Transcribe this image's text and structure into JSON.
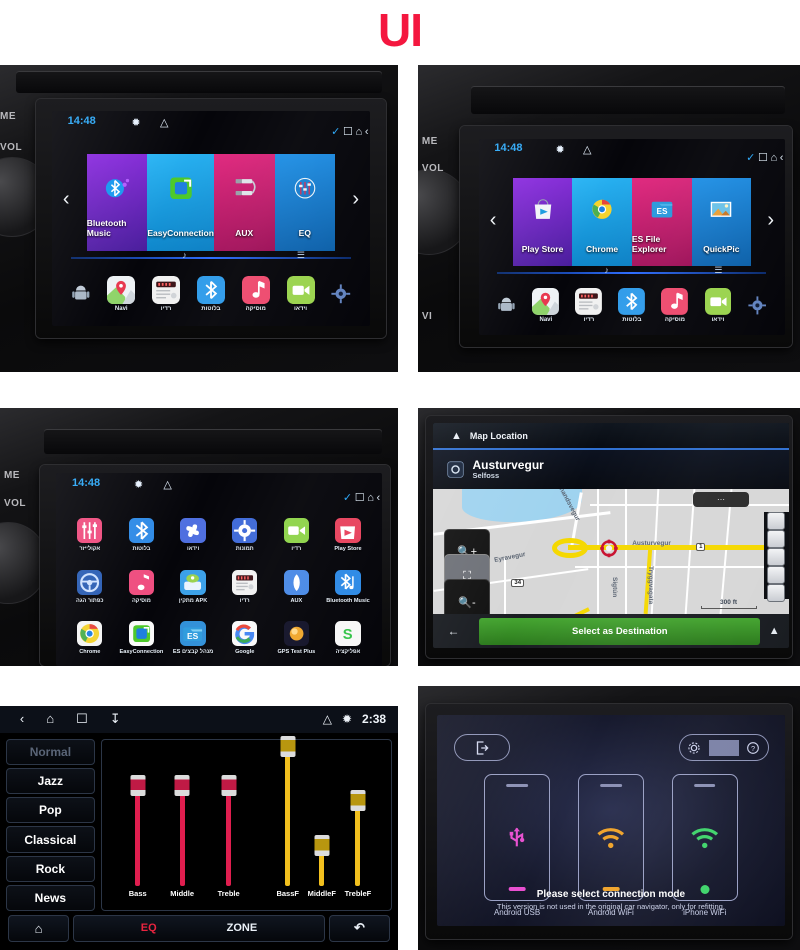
{
  "page": {
    "title": "UI",
    "title_color": "#f4173f"
  },
  "panel1": {
    "name": "car-head-unit-home-media",
    "dash_labels": [
      "ME",
      "VOL"
    ],
    "status": {
      "clock": "14:48",
      "bluetooth_icon": "bluetooth-icon",
      "eject_icon": "eject-icon"
    },
    "nav": {
      "check_icon": "check-icon",
      "recents_icon": "recents-icon",
      "home_icon": "home-icon",
      "back_icon": "back-icon"
    },
    "arrows": {
      "left": "‹",
      "right": "›"
    },
    "tiles": [
      {
        "label": "Bluetooth Music",
        "icon": "bluetooth-music-icon",
        "color": "#7b1fd6"
      },
      {
        "label": "EasyConnection",
        "icon": "easyconnection-icon",
        "color": "#19a8e8"
      },
      {
        "label": "AUX",
        "icon": "aux-rca-icon",
        "color": "#d6197b"
      },
      {
        "label": "EQ",
        "icon": "equalizer-icon",
        "color": "#1a7fd6"
      }
    ],
    "dock": [
      {
        "label": "Navi",
        "icon": "maps-pin-icon"
      },
      {
        "label": "רדיו",
        "icon": "radio-icon"
      },
      {
        "label": "בלוטות",
        "icon": "bluetooth-icon"
      },
      {
        "label": "מוסיקה",
        "icon": "music-note-icon"
      },
      {
        "label": "וידאו",
        "icon": "video-camera-icon"
      }
    ],
    "sys_left_icon": "android-robot-icon",
    "sys_right_icon": "settings-gear-icon",
    "dockbar_left_icon": "music-swirl-icon",
    "dockbar_right_icon": "signal-bars-icon"
  },
  "panel2": {
    "name": "car-head-unit-home-apps",
    "dash_labels": [
      "ME",
      "VOL",
      "VI"
    ],
    "status": {
      "clock": "14:48",
      "bluetooth_icon": "bluetooth-icon",
      "eject_icon": "eject-icon"
    },
    "nav": {
      "check_icon": "check-icon",
      "recents_icon": "recents-icon",
      "home_icon": "home-icon",
      "back_icon": "back-icon"
    },
    "arrows": {
      "left": "‹",
      "right": "›"
    },
    "tiles": [
      {
        "label": "Play Store",
        "icon": "play-store-icon",
        "color": "#7b1fd6"
      },
      {
        "label": "Chrome",
        "icon": "chrome-icon",
        "color": "#19a8e8"
      },
      {
        "label": "ES File Explorer",
        "icon": "es-file-explorer-icon",
        "color": "#d6197b"
      },
      {
        "label": "QuickPic",
        "icon": "quickpic-icon",
        "color": "#1a7fd6"
      }
    ],
    "dock": [
      {
        "label": "Navi",
        "icon": "maps-pin-icon"
      },
      {
        "label": "רדיו",
        "icon": "radio-icon"
      },
      {
        "label": "בלוטות",
        "icon": "bluetooth-icon"
      },
      {
        "label": "מוסיקה",
        "icon": "music-note-icon"
      },
      {
        "label": "וידאו",
        "icon": "video-camera-icon"
      }
    ]
  },
  "panel3": {
    "name": "car-head-unit-app-drawer",
    "dash_labels": [
      "ME",
      "VOL"
    ],
    "status": {
      "clock": "14:48",
      "bluetooth_icon": "bluetooth-icon",
      "eject_icon": "eject-icon"
    },
    "nav": {
      "check_icon": "check-icon",
      "recents_icon": "recents-icon",
      "home_icon": "home-icon",
      "back_icon": "back-icon"
    },
    "apps": [
      {
        "label": "אקולייזר",
        "icon": "equalizer-icon",
        "color": "#ef4d7f"
      },
      {
        "label": "בלוטות",
        "icon": "bluetooth-icon",
        "color": "#2e8ae6"
      },
      {
        "label": "וידאו",
        "icon": "fan-icon",
        "color": "#4f6fe0"
      },
      {
        "label": "תמונות",
        "icon": "settings-gear-icon",
        "color": "#3f6ad8"
      },
      {
        "label": "רדיו",
        "icon": "video-camera-icon",
        "color": "#8ed44a"
      },
      {
        "label": "Play Store",
        "icon": "play-store-icon",
        "color": "#e8445e"
      },
      {
        "label": "כפתור הגה",
        "icon": "steering-wheel-icon",
        "color": "#2c5fb5"
      },
      {
        "label": "מוסיקה",
        "icon": "music-note-icon",
        "color": "#ef4d7f"
      },
      {
        "label": "מתקין APK",
        "icon": "apk-installer-icon",
        "color": "#3aa0e8"
      },
      {
        "label": "רדיו",
        "icon": "radio-icon",
        "color": "#f2f2f2"
      },
      {
        "label": "AUX",
        "icon": "aux-jack-icon",
        "color": "#4a8ae6"
      },
      {
        "label": "Bluetooth Music",
        "icon": "bluetooth-music-icon",
        "color": "#2e8ae6"
      },
      {
        "label": "Chrome",
        "icon": "chrome-icon",
        "color": "#f5f5f5"
      },
      {
        "label": "EasyConnection",
        "icon": "easyconnection-icon",
        "color": "#fafafa"
      },
      {
        "label": "ES מנהל קבצים",
        "icon": "es-file-explorer-icon",
        "color": "#2f8fd8"
      },
      {
        "label": "Google",
        "icon": "google-icon",
        "color": "#fafafa"
      },
      {
        "label": "GPS Test Plus",
        "icon": "gps-test-plus-icon",
        "color": "#1a1a2e"
      },
      {
        "label": "אפליקציה",
        "icon": "s-app-icon",
        "color": "#f7f7f7"
      }
    ]
  },
  "panel4": {
    "name": "navigation-map-location",
    "header_title": "Map Location",
    "place_name": "Austurvegur",
    "place_city": "Selfoss",
    "action_button": "Select as Destination",
    "back_icon": "back-arrow-icon",
    "expand_icon": "chevron-up-icon",
    "zoom_in_icon": "zoom-in-icon",
    "recenter_icon": "recenter-icon",
    "zoom_out_icon": "zoom-out-icon",
    "scale_label": "300 ft",
    "street_labels": [
      "Ólunandsvegur",
      "Eyravegur",
      "Austurvegur",
      "Sigtún",
      "Tryggvagata"
    ],
    "route_shields": [
      "1",
      "34"
    ],
    "poi_buttons": [
      "poi-fuel-icon",
      "poi-food-icon",
      "poi-parking-icon",
      "poi-hotel-icon",
      "poi-more-icon"
    ]
  },
  "panel5": {
    "name": "equalizer-screen",
    "statusbar": {
      "back_icon": "back-icon",
      "home_icon": "home-icon",
      "recents_icon": "recents-icon",
      "download_icon": "download-icon",
      "eject_icon": "eject-icon",
      "bluetooth_icon": "bluetooth-icon",
      "clock": "2:38"
    },
    "presets": [
      {
        "label": "Normal",
        "selected": true
      },
      {
        "label": "Jazz",
        "selected": false
      },
      {
        "label": "Pop",
        "selected": false
      },
      {
        "label": "Classical",
        "selected": false
      },
      {
        "label": "Rock",
        "selected": false
      },
      {
        "label": "News",
        "selected": false
      }
    ],
    "sliders": [
      {
        "label": "Bass",
        "value": 62,
        "color": "#e01e4f"
      },
      {
        "label": "Middle",
        "value": 62,
        "color": "#e01e4f"
      },
      {
        "label": "Treble",
        "value": 62,
        "color": "#e01e4f"
      },
      {
        "label": "BassF",
        "value": 88,
        "color": "#f2c01e"
      },
      {
        "label": "MiddleF",
        "value": 22,
        "color": "#f2c01e"
      },
      {
        "label": "TrebleF",
        "value": 52,
        "color": "#f2c01e"
      }
    ],
    "bottom": {
      "home_icon": "home-icon",
      "eq_label": "EQ",
      "zone_label": "ZONE",
      "back_icon": "return-icon",
      "eq_color": "#e8243f"
    }
  },
  "panel6": {
    "name": "connection-mode-screen",
    "exit_icon": "exit-icon",
    "settings_icon": "gear-icon",
    "help_icon": "help-icon",
    "options": [
      {
        "label": "Android USB",
        "icon": "usb-icon",
        "color": "#e84fd0"
      },
      {
        "label": "Android WiFi",
        "icon": "wifi-icon",
        "color": "#f0a32a"
      },
      {
        "label": "iPhone WiFi",
        "icon": "wifi-icon",
        "color": "#3fd46b"
      }
    ],
    "message_primary": "Please select connection mode",
    "message_secondary": "This version is not used in the original car navigator, only for refitting."
  }
}
